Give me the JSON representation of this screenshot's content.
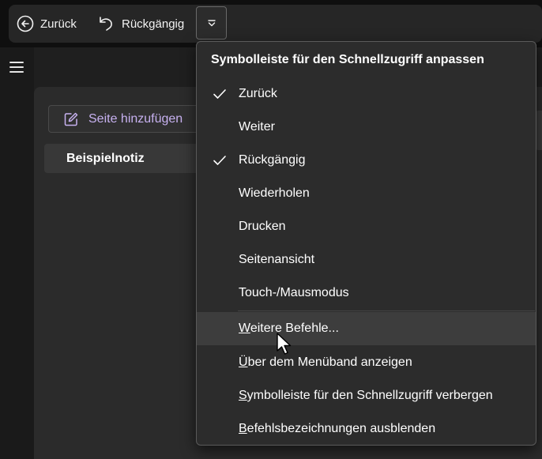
{
  "toolbar": {
    "back_label": "Zurück",
    "undo_label": "Rückgängig"
  },
  "sidebar": {
    "add_page_label": "Seite hinzufügen",
    "pages": [
      {
        "title": "Beispielnotiz"
      }
    ]
  },
  "menu": {
    "title": "Symbolleiste für den Schnellzugriff anpassen",
    "items": [
      {
        "label": "Zurück",
        "checked": true
      },
      {
        "label": "Weiter",
        "checked": false
      },
      {
        "label": "Rückgängig",
        "checked": true
      },
      {
        "label": "Wiederholen",
        "checked": false
      },
      {
        "label": "Drucken",
        "checked": false
      },
      {
        "label": "Seitenansicht",
        "checked": false
      },
      {
        "label": "Touch-/Mausmodus",
        "checked": false
      }
    ],
    "commands": [
      {
        "accel": "W",
        "rest": "eitere Befehle...",
        "hovered": true
      },
      {
        "accel": "Ü",
        "rest": "ber dem Menüband anzeigen",
        "hovered": false
      },
      {
        "accel": "S",
        "rest": "ymbolleiste für den Schnellzugriff verbergen",
        "hovered": false
      },
      {
        "accel": "B",
        "rest": "efehlsbezeichnungen ausblenden",
        "hovered": false
      }
    ]
  },
  "colors": {
    "accent": "#c7b1f0",
    "menu_bg": "#2c2c2c",
    "hover_bg": "#3d3d3d"
  }
}
